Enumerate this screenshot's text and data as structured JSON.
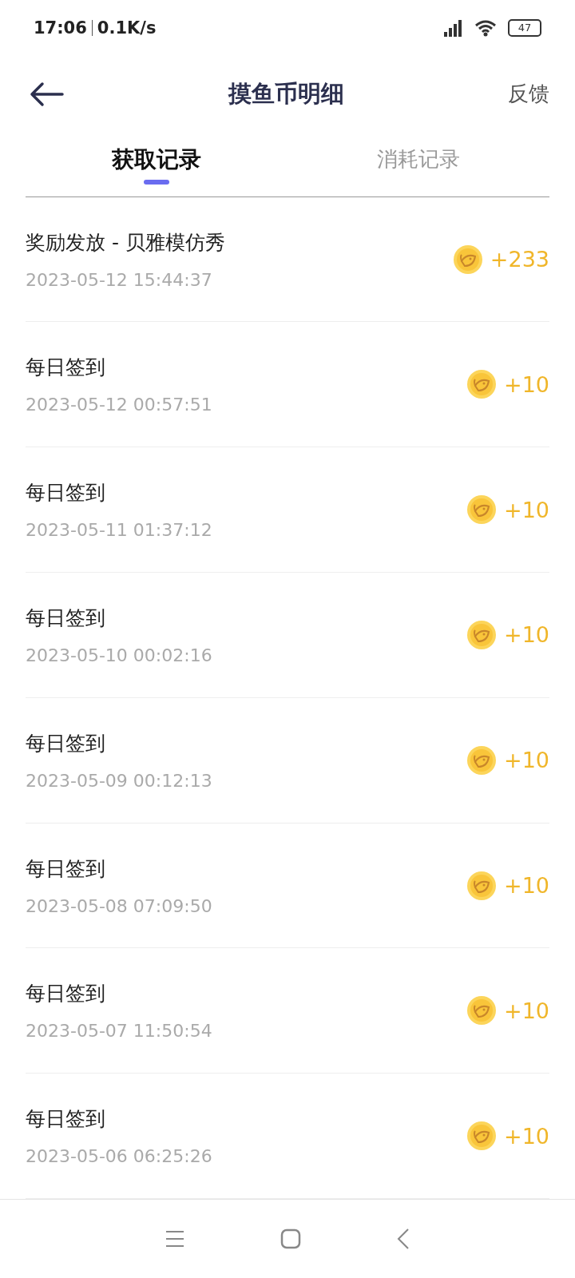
{
  "status_bar": {
    "time": "17:06",
    "speed": "0.1K/s",
    "battery": "47"
  },
  "header": {
    "title": "摸鱼币明细",
    "action": "反馈"
  },
  "tabs": [
    {
      "label": "获取记录",
      "selected": true
    },
    {
      "label": "消耗记录",
      "selected": false
    }
  ],
  "records": [
    {
      "title": "奖励发放 - 贝雅模仿秀",
      "time": "2023-05-12 15:44:37",
      "amount": "+233"
    },
    {
      "title": "每日签到",
      "time": "2023-05-12 00:57:51",
      "amount": "+10"
    },
    {
      "title": "每日签到",
      "time": "2023-05-11 01:37:12",
      "amount": "+10"
    },
    {
      "title": "每日签到",
      "time": "2023-05-10 00:02:16",
      "amount": "+10"
    },
    {
      "title": "每日签到",
      "time": "2023-05-09 00:12:13",
      "amount": "+10"
    },
    {
      "title": "每日签到",
      "time": "2023-05-08 07:09:50",
      "amount": "+10"
    },
    {
      "title": "每日签到",
      "time": "2023-05-07 11:50:54",
      "amount": "+10"
    },
    {
      "title": "每日签到",
      "time": "2023-05-06 06:25:26",
      "amount": "+10"
    }
  ]
}
